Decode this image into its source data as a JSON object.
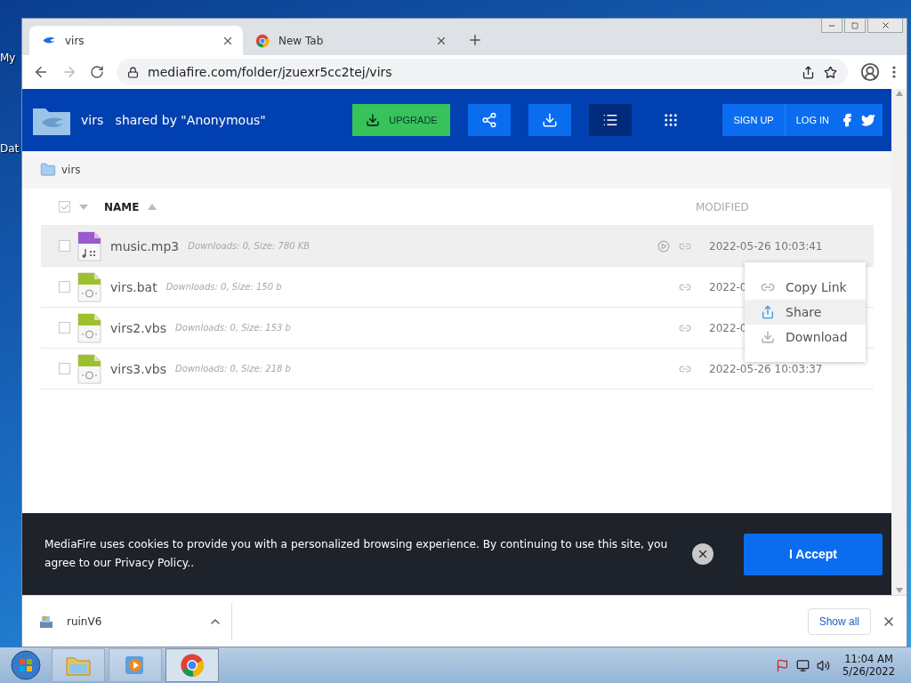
{
  "desktop": {
    "icons": [
      {
        "label": "My"
      },
      {
        "label": "Dat"
      }
    ]
  },
  "browser": {
    "tabs": [
      {
        "title": "virs",
        "kind": "mediafire",
        "selected": true
      },
      {
        "title": "New Tab",
        "kind": "chrome",
        "selected": false
      }
    ],
    "address": "mediafire.com/folder/jzuexr5cc2tej/virs"
  },
  "site": {
    "folder_name": "virs",
    "shared_by": "shared by \"Anonymous\"",
    "upgrade": "UPGRADE",
    "view_modes": [
      {
        "kind": "list",
        "selected": true
      },
      {
        "kind": "grid",
        "selected": false
      }
    ],
    "sign_up": "SIGN UP",
    "log_in": "LOG IN",
    "breadcrumb": "virs"
  },
  "table": {
    "select_all_checked": true,
    "columns": [
      "NAME",
      "MODIFIED"
    ],
    "rows": [
      {
        "name": "music.mp3",
        "kind": "audio",
        "meta": "Downloads: 0, Size: 780 KB",
        "modified": "2022-05-26 10:03:41",
        "hovered": true,
        "checked": false
      },
      {
        "name": "virs.bat",
        "kind": "script",
        "meta": "Downloads: 0, Size: 150 b",
        "modified": "2022-0",
        "hovered": false,
        "checked": false
      },
      {
        "name": "virs2.vbs",
        "kind": "script",
        "meta": "Downloads: 0, Size: 153 b",
        "modified": "2022-0",
        "hovered": false,
        "checked": false
      },
      {
        "name": "virs3.vbs",
        "kind": "script",
        "meta": "Downloads: 0, Size: 218 b",
        "modified": "2022-05-26 10:03:37",
        "hovered": false,
        "checked": false
      }
    ]
  },
  "context_menu": [
    {
      "label": "Copy Link",
      "kind": "link",
      "selected": false
    },
    {
      "label": "Share",
      "kind": "share",
      "selected": true
    },
    {
      "label": "Download",
      "kind": "download",
      "selected": false
    }
  ],
  "cookie_banner": {
    "text": "MediaFire uses cookies to provide you with a personalized browsing experience. By continuing to use this site, you agree to our Privacy Policy..",
    "accept": "I Accept"
  },
  "download_bar": {
    "file": "ruinV6",
    "show_all": "Show all"
  },
  "taskbar": {
    "apps": [
      {
        "kind": "explorer",
        "selected": false
      },
      {
        "kind": "media",
        "selected": false
      },
      {
        "kind": "chrome",
        "selected": true
      }
    ],
    "time": "11:04 AM",
    "date": "5/26/2022"
  }
}
